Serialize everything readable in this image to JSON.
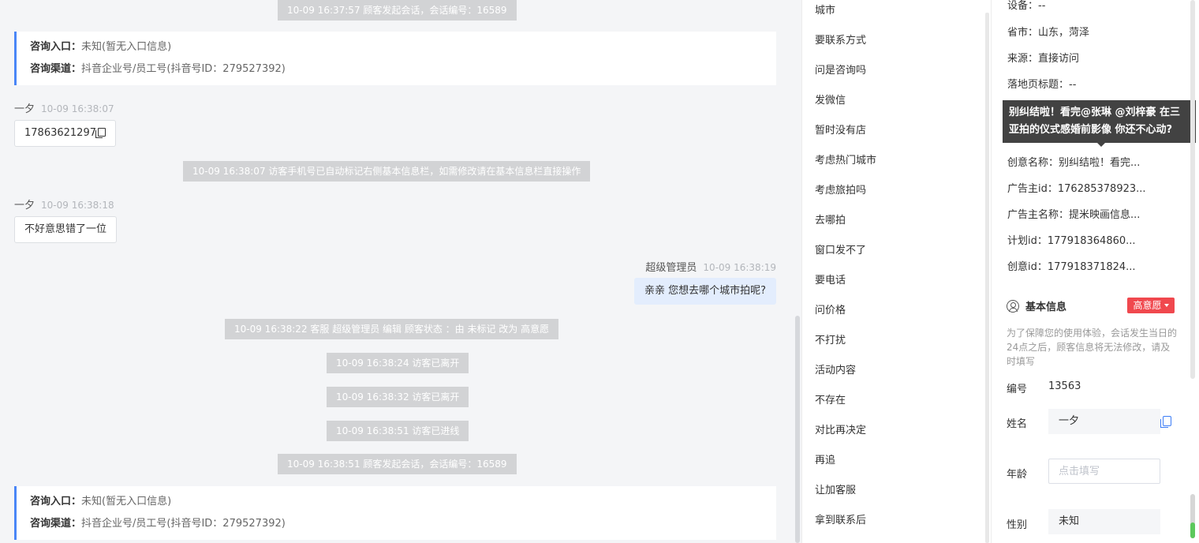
{
  "chat": {
    "system_messages": [
      "10-09 16:37:57 顾客发起会话，会话编号：16589",
      "10-09 16:38:07 访客手机号已自动标记右侧基本信息栏，如需修改请在基本信息栏直接操作",
      "10-09 16:38:22 客服 超级管理员 编辑 顾客状态 ：由 未标记 改为 高意愿",
      "10-09 16:38:24 访客已离开",
      "10-09 16:38:32 访客已离开",
      "10-09 16:38:51 访客已进线",
      "10-09 16:38:51 顾客发起会话，会话编号：16589"
    ],
    "info_cards": [
      {
        "entry_label": "咨询入口：",
        "entry_value": "未知(暂无入口信息)",
        "channel_label": "咨询渠道：",
        "channel_value": "抖音企业号/员工号(抖音号ID：279527392)"
      },
      {
        "entry_label": "咨询入口：",
        "entry_value": "未知(暂无入口信息)",
        "channel_label": "咨询渠道：",
        "channel_value": "抖音企业号/员工号(抖音号ID：279527392)"
      }
    ],
    "messages": [
      {
        "sender": "一夕",
        "time": "10-09 16:38:07",
        "text": "17863621297"
      },
      {
        "sender": "一夕",
        "time": "10-09 16:38:18",
        "text": "不好意思错了一位"
      },
      {
        "sender": "超级管理员",
        "time": "10-09 16:38:19",
        "text": "亲亲 您想去哪个城市拍呢?"
      }
    ]
  },
  "quick_tags": [
    "城市",
    "要联系方式",
    "问是咨询吗",
    "发微信",
    "暂时没有店",
    "考虑热门城市",
    "考虑旅拍吗",
    "去哪拍",
    "窗口发不了",
    "要电话",
    "问价格",
    "不打扰",
    "活动内容",
    "不存在",
    "对比再决定",
    "再追",
    "让加客服",
    "拿到联系后"
  ],
  "visitor_info": [
    {
      "label": "设备：",
      "value": "--"
    },
    {
      "label": "省市：",
      "value": "山东，菏泽"
    },
    {
      "label": "来源：",
      "value": "直接访问"
    },
    {
      "label": "落地页标题：",
      "value": "--"
    },
    {
      "label": "创意名称：",
      "value": "别纠结啦！看完..."
    },
    {
      "label": "广告主id：",
      "value": "176285378923..."
    },
    {
      "label": "广告主名称：",
      "value": "提米映画信息..."
    },
    {
      "label": "计划id：",
      "value": "177918364860..."
    },
    {
      "label": "创意id：",
      "value": "177918371824..."
    }
  ],
  "tooltip_text": "别纠结啦！看完@张琳 @刘梓豪 在三亚拍的仪式感婚前影像 你还不心动?",
  "basic_info": {
    "title": "基本信息",
    "intent_badge": "高意愿",
    "notice": "为了保障您的使用体验，会话发生当日的24点之后，顾客信息将无法修改，请及时填写",
    "number_label": "编号",
    "number_value": "13563",
    "name_label": "姓名",
    "name_value": "一夕",
    "age_label": "年龄",
    "age_placeholder": "点击填写",
    "gender_label": "性别",
    "gender_value": "未知"
  },
  "colors": {
    "accent": "#4a86f7",
    "badge": "#f0484e",
    "my_bubble": "#e3edfd",
    "system_pill": "#d2d3d5"
  }
}
